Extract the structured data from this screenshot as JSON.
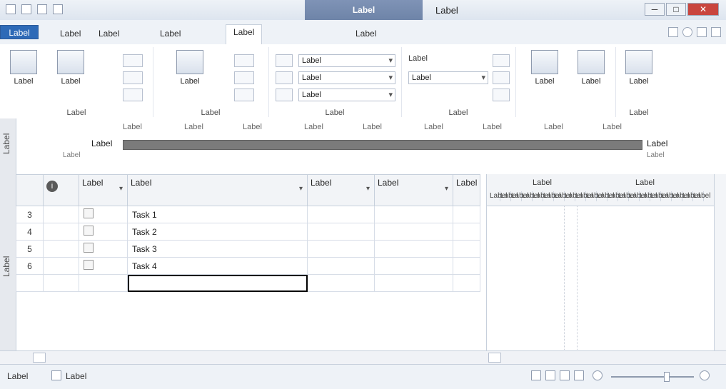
{
  "window": {
    "context_tab_group": "Label",
    "title": "Label",
    "buttons": [
      "─",
      "□",
      "✕"
    ]
  },
  "tabs": [
    "Label",
    "Label",
    "Label",
    "Label",
    "Label",
    "Label"
  ],
  "ribbon": {
    "groups": {
      "task_views": {
        "label": "Label",
        "btn1": "Label",
        "btn2": "Label"
      },
      "resource_views": {
        "label": "Label",
        "btn1": "Label"
      },
      "data": {
        "label": "Label",
        "filter1": "Label",
        "filter2": "Label",
        "filter3": "Label"
      },
      "zoom": {
        "label": "Label",
        "timescale_label": "Label",
        "timescale_value": "Label"
      },
      "window_group": {
        "split_label": "Label",
        "window_label": "Label"
      },
      "macros": {
        "label": "Label",
        "btn": "Label"
      }
    }
  },
  "timeline": {
    "side_label": "Label",
    "start_label": "Label",
    "start_date": "Label",
    "end_label": "Label",
    "end_date": "Label",
    "ticks": [
      "Label",
      "Label",
      "Label",
      "Label",
      "Label",
      "Label",
      "Label",
      "Label",
      "Label"
    ]
  },
  "gantt": {
    "side_label": "Label",
    "headers": {
      "mode": "Label",
      "name": "Label",
      "duration": "Label",
      "start": "Label",
      "finish_short": "Label"
    },
    "rows": [
      {
        "id": "3",
        "name": "Task 1"
      },
      {
        "id": "4",
        "name": "Task 2"
      },
      {
        "id": "5",
        "name": "Task 3"
      },
      {
        "id": "6",
        "name": "Task 4"
      }
    ]
  },
  "chart": {
    "week1": "Label",
    "week2": "Label",
    "days": [
      "Label",
      "Label",
      "Label",
      "Label",
      "Label",
      "Label",
      "Label",
      "Label",
      "Label",
      "Label",
      "Label",
      "Label",
      "Label",
      "Label",
      "Label",
      "Label",
      "Label",
      "Label",
      "Label",
      "Label"
    ]
  },
  "status": {
    "ready": "Label",
    "new_tasks": "Label"
  },
  "icons": {
    "file-icon": "▣",
    "save-icon": "▣",
    "undo-icon": "↶",
    "redo-icon": "↷",
    "help-icon": "?",
    "info-icon": "i",
    "pin-icon": "📌"
  }
}
